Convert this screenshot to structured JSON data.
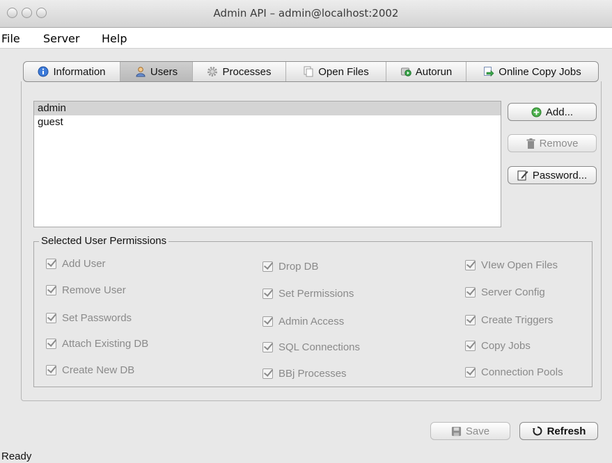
{
  "window": {
    "title": "Admin API – admin@localhost:2002"
  },
  "menu": [
    "File",
    "Server",
    "Help"
  ],
  "tabs": [
    {
      "label": "Information",
      "icon": "info-icon",
      "active": false
    },
    {
      "label": "Users",
      "icon": "user-icon",
      "active": true
    },
    {
      "label": "Processes",
      "icon": "gear-icon",
      "active": false
    },
    {
      "label": "Open Files",
      "icon": "files-icon",
      "active": false
    },
    {
      "label": "Autorun",
      "icon": "autorun-icon",
      "active": false
    },
    {
      "label": "Online Copy Jobs",
      "icon": "copy-jobs-icon",
      "active": false
    }
  ],
  "users": [
    {
      "name": "admin",
      "selected": true
    },
    {
      "name": "guest",
      "selected": false
    }
  ],
  "buttons": {
    "add": "Add...",
    "remove": "Remove",
    "password": "Password...",
    "save": "Save",
    "refresh": "Refresh"
  },
  "permissions": {
    "legend": "Selected User Permissions",
    "col1": [
      "Add User",
      "Remove User",
      "Set Passwords",
      "Attach Existing DB",
      "Create New DB"
    ],
    "col2": [
      "Drop DB",
      "Set Permissions",
      "Admin Access",
      "SQL Connections",
      "BBj Processes"
    ],
    "col3": [
      "VIew Open Files",
      "Server Config",
      "Create Triggers",
      "Copy Jobs",
      "Connection Pools"
    ]
  },
  "status": "Ready",
  "colors": {
    "selection": "#d4d4d4",
    "disabled_text": "#8a8a8a"
  }
}
